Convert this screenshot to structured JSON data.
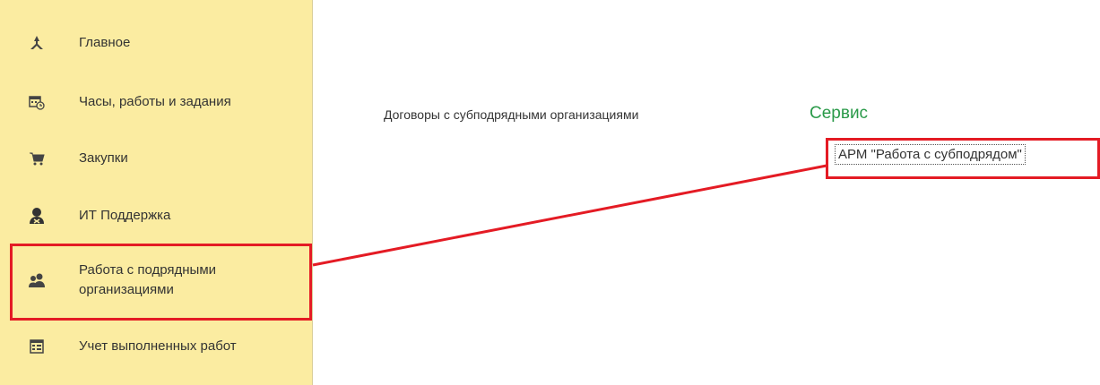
{
  "sidebar": {
    "items": [
      {
        "label": "Главное",
        "icon": "home-icon"
      },
      {
        "label": "Часы, работы и задания",
        "icon": "calendar-clock-icon"
      },
      {
        "label": "Закупки",
        "icon": "cart-icon"
      },
      {
        "label": "ИТ Поддержка",
        "icon": "support-agent-icon"
      },
      {
        "label": "Работа с подрядными организациями",
        "icon": "users-icon",
        "highlighted": true
      },
      {
        "label": "Учет выполненных работ",
        "icon": "report-icon"
      }
    ]
  },
  "main": {
    "link": "Договоры с субподрядными организациями",
    "section_title": "Сервис",
    "command": "АРМ \"Работа с субподрядом\""
  },
  "colors": {
    "sidebar_bg": "#fbeca1",
    "highlight": "#e41b24",
    "section_title": "#2a9a49"
  }
}
